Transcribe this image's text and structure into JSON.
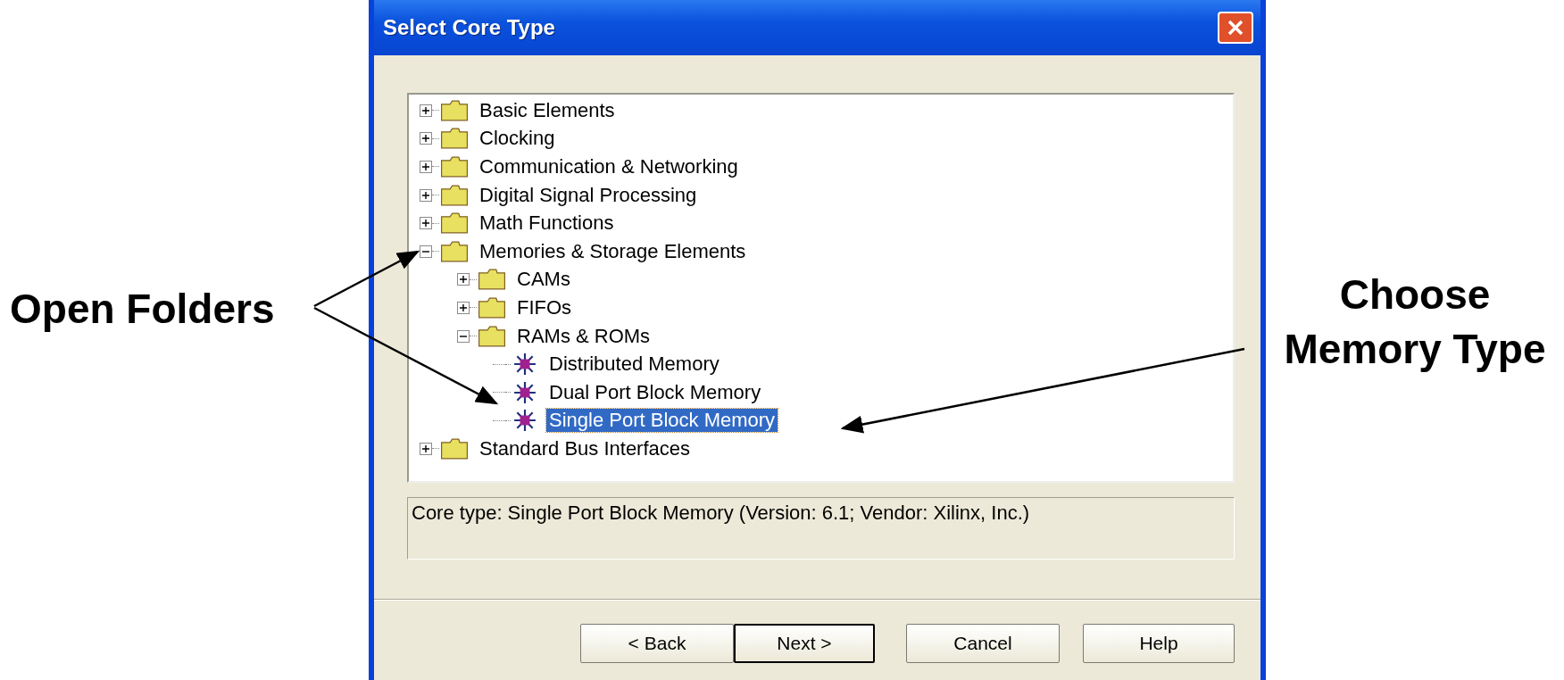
{
  "window": {
    "title": "Select Core Type"
  },
  "tree": [
    {
      "kind": "folder",
      "label": "Basic Elements",
      "expanded": false,
      "selected": false
    },
    {
      "kind": "folder",
      "label": "Clocking",
      "expanded": false,
      "selected": false
    },
    {
      "kind": "folder",
      "label": "Communication & Networking",
      "expanded": false,
      "selected": false
    },
    {
      "kind": "folder",
      "label": "Digital Signal Processing",
      "expanded": false,
      "selected": false
    },
    {
      "kind": "folder",
      "label": "Math Functions",
      "expanded": false,
      "selected": false
    },
    {
      "kind": "folder",
      "label": "Memories & Storage Elements",
      "expanded": true,
      "selected": false,
      "children": [
        {
          "kind": "folder",
          "label": "CAMs",
          "expanded": false,
          "selected": false
        },
        {
          "kind": "folder",
          "label": "FIFOs",
          "expanded": false,
          "selected": false
        },
        {
          "kind": "folder",
          "label": "RAMs & ROMs",
          "expanded": true,
          "selected": false,
          "children": [
            {
              "kind": "core",
              "label": "Distributed Memory",
              "selected": false
            },
            {
              "kind": "core",
              "label": "Dual Port Block Memory",
              "selected": false
            },
            {
              "kind": "core",
              "label": "Single Port Block Memory",
              "selected": true
            }
          ]
        }
      ]
    },
    {
      "kind": "folder",
      "label": "Standard Bus Interfaces",
      "expanded": false,
      "selected": false
    }
  ],
  "status": "Core type: Single Port Block Memory (Version: 6.1; Vendor: Xilinx, Inc.)",
  "buttons": [
    {
      "label": "< Back",
      "default": false
    },
    {
      "label": "Next >",
      "default": true
    },
    {
      "label": "Cancel",
      "default": false
    },
    {
      "label": "Help",
      "default": false
    }
  ],
  "callouts": {
    "left": "Open Folders",
    "right": "Choose Memory Type"
  }
}
